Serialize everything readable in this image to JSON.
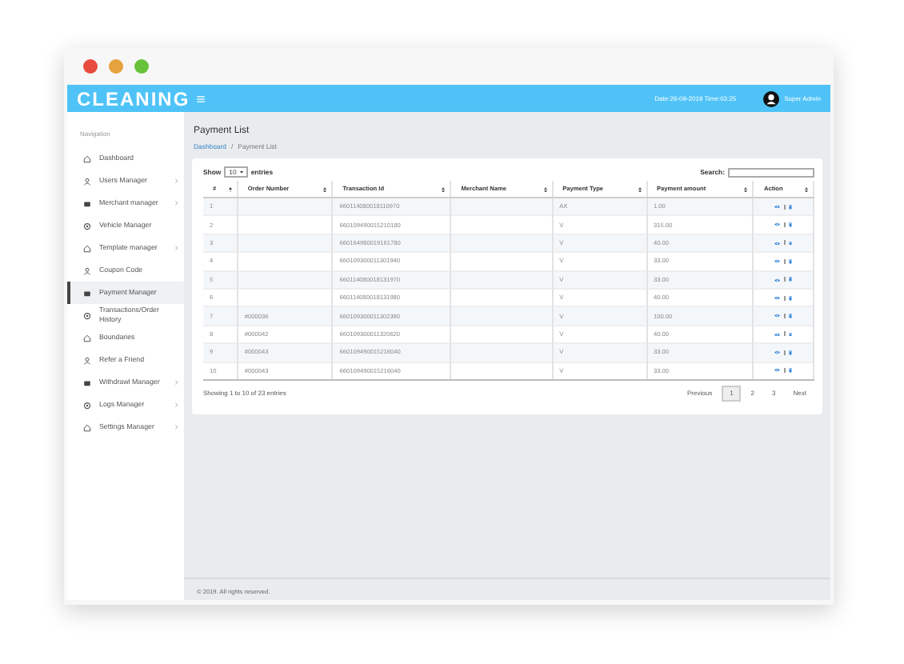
{
  "header": {
    "logo": "CLEANING",
    "datetime": "Date:26-09-2019 Time:03:25",
    "user": "Super Admin"
  },
  "sidebar": {
    "heading": "Navigation",
    "items": [
      {
        "label": "Dashboard",
        "expandable": false,
        "selected": false
      },
      {
        "label": "Users Manager",
        "expandable": true,
        "selected": false
      },
      {
        "label": "Merchant manager",
        "expandable": true,
        "selected": false
      },
      {
        "label": "Vehicle Manager",
        "expandable": false,
        "selected": false
      },
      {
        "label": "Template manager",
        "expandable": true,
        "selected": false
      },
      {
        "label": "Coupon Code",
        "expandable": false,
        "selected": false
      },
      {
        "label": "Payment Manager",
        "expandable": false,
        "selected": true
      },
      {
        "label": "Transactions/Order History",
        "expandable": false,
        "selected": false
      },
      {
        "label": "Boundaries",
        "expandable": false,
        "selected": false
      },
      {
        "label": "Refer a Friend",
        "expandable": false,
        "selected": false
      },
      {
        "label": "Withdrawl Manager",
        "expandable": true,
        "selected": false
      },
      {
        "label": "Logs Manager",
        "expandable": true,
        "selected": false
      },
      {
        "label": "Settings Manager",
        "expandable": true,
        "selected": false
      }
    ]
  },
  "page": {
    "title": "Payment List",
    "breadcrumb_separator": "/",
    "breadcrumb": [
      {
        "label": "Dashboard",
        "link": true
      },
      {
        "label": "Payment List",
        "link": false
      }
    ]
  },
  "table": {
    "length_label": "Show",
    "length_value": "10",
    "length_suffix": "entries",
    "search_label": "Search:",
    "columns": [
      "#",
      "Order Number",
      "Transaction Id",
      "Merchant Name",
      "Payment Type",
      "Payment amount",
      "Action"
    ],
    "rows": [
      [
        "1",
        "",
        "660114080018110970",
        "",
        "AX",
        "1.00"
      ],
      [
        "2",
        "",
        "660109490015210180",
        "",
        "V",
        "315.00"
      ],
      [
        "3",
        "",
        "660164980019161780",
        "",
        "V",
        "40.00"
      ],
      [
        "4",
        "",
        "660109300011301940",
        "",
        "V",
        "33.00"
      ],
      [
        "5",
        "",
        "660114080018131970",
        "",
        "V",
        "33.00"
      ],
      [
        "6",
        "",
        "660114080018131980",
        "",
        "V",
        "40.00"
      ],
      [
        "7",
        "#000036",
        "660109300011302390",
        "",
        "V",
        "100.00"
      ],
      [
        "8",
        "#000042",
        "660109300011320620",
        "",
        "V",
        "40.00"
      ],
      [
        "9",
        "#000043",
        "660109490015216040",
        "",
        "V",
        "33.00"
      ],
      [
        "10",
        "#000043",
        "660109490015216040",
        "",
        "V",
        "33.00"
      ]
    ],
    "info": "Showing 1 to 10 of 23 entries",
    "pagination": [
      {
        "label": "Previous",
        "selected": false
      },
      {
        "label": "1",
        "selected": true
      },
      {
        "label": "2",
        "selected": false
      },
      {
        "label": "3",
        "selected": false
      },
      {
        "label": "Next",
        "selected": false
      }
    ]
  },
  "footer": "© 2019. All rights reserved."
}
